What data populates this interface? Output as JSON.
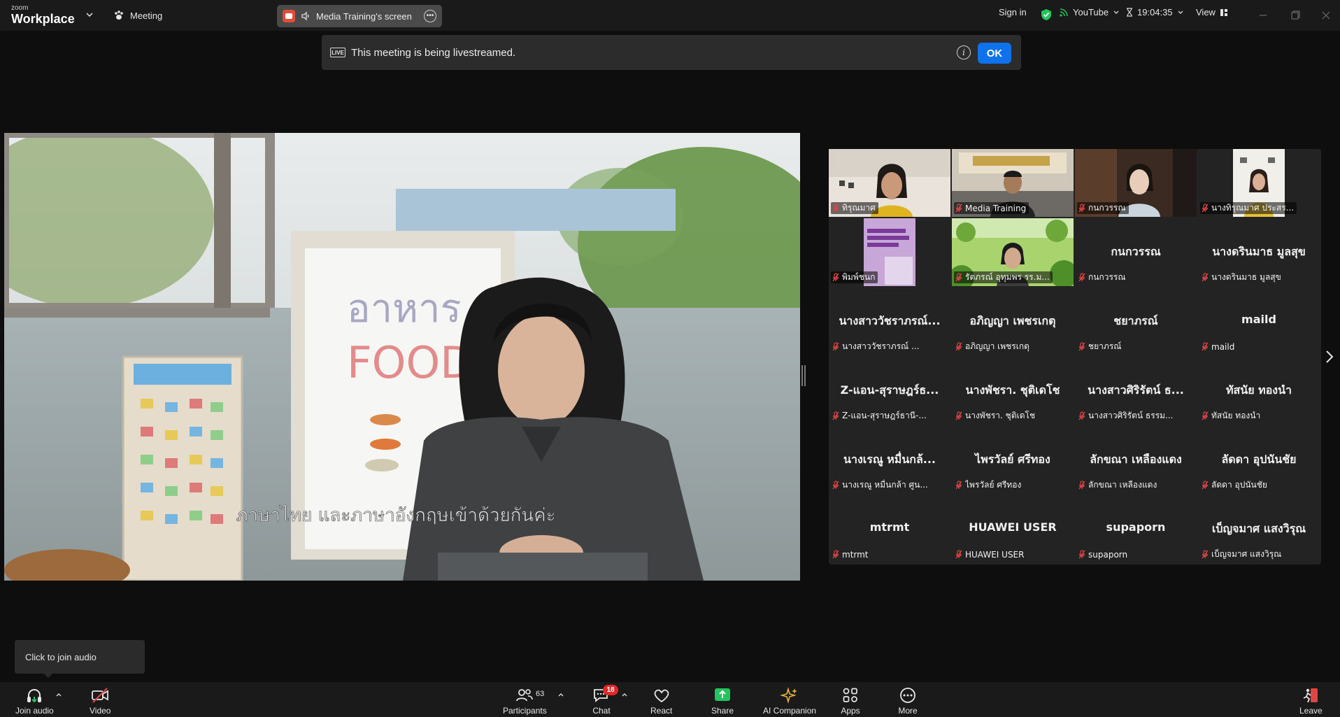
{
  "topbar": {
    "brand_small": "zoom",
    "brand_big": "Workplace",
    "meeting_label": "Meeting",
    "screen_label": "Media Training's screen",
    "sign_in": "Sign in",
    "stream_label": "YouTube",
    "timer": "19:04:35",
    "view_label": "View"
  },
  "banner": {
    "badge": "LIVE",
    "text": "This meeting is being livestreamed.",
    "ok": "OK"
  },
  "share": {
    "board_text": "อาหาร",
    "board_en": "FOOD",
    "subtitle": "ภาษาไทย และภาษาอังกฤษเข้าด้วยกันค่ะ"
  },
  "gallery": {
    "tiles": [
      {
        "big": "",
        "label": "ทิรุณมาศ",
        "video": true
      },
      {
        "big": "",
        "label": "Media Training",
        "video": true,
        "active": true
      },
      {
        "big": "",
        "label": "กนกวรรณ",
        "video": true
      },
      {
        "big": "",
        "label": "นางทิรุณมาศ ประสร...",
        "video": true
      },
      {
        "big": "",
        "label": "พิมพ์ชนก",
        "video": true
      },
      {
        "big": "",
        "label": "รัตภรณ์ อุทุมพร รร.ม...",
        "video": true
      },
      {
        "big": "กนกวรรณ",
        "label": "กนกวรรณ"
      },
      {
        "big": "นางดรินมาธ มูลสุข",
        "label": "นางดรินมาธ มูลสุข"
      },
      {
        "big": "นางสาววัชราภรณ์...",
        "label": "นางสาววัชราภรณ์ ..."
      },
      {
        "big": "อภิญญา เพชรเกตุ",
        "label": "อภิญญา เพชรเกตุ"
      },
      {
        "big": "ชยาภรณ์",
        "label": "ชยาภรณ์"
      },
      {
        "big": "maild",
        "label": "maild"
      },
      {
        "big": "Z-แอน-สุราษฎร์ธ...",
        "label": "Z-แอน-สุราษฎร์ธานี-..."
      },
      {
        "big": "นางพัชรา. ชุติเดโช",
        "label": "นางพัชรา. ชุติเดโช"
      },
      {
        "big": "นางสาวศิริรัตน์ ธ...",
        "label": "นางสาวศิริรัตน์ ธรรม..."
      },
      {
        "big": "ทัสนัย ทองนำ",
        "label": "ทัสนัย ทองนำ"
      },
      {
        "big": "นางเรณู หมื่นกล้...",
        "label": "นางเรณู หมื่นกล้า ศูน..."
      },
      {
        "big": "ไพรวัลย์ ศรีทอง",
        "label": "ไพรวัลย์ ศรีทอง"
      },
      {
        "big": "ลักขณา เหลืองแดง",
        "label": "ลักขณา เหลืองแดง"
      },
      {
        "big": "ลัดดา อุปนันชัย",
        "label": "ลัดดา อุปนันชัย"
      },
      {
        "big": "mtrmt",
        "label": "mtrmt"
      },
      {
        "big": "HUAWEI USER",
        "label": "HUAWEI USER"
      },
      {
        "big": "supaporn",
        "label": "supaporn"
      },
      {
        "big": "เบ็ญจมาศ แสงวิรุณ",
        "label": "เบ็ญจมาศ แสงวิรุณ"
      }
    ]
  },
  "tooltip": "Click to join audio",
  "toolbar": {
    "join_audio": "Join audio",
    "video": "Video",
    "participants": "Participants",
    "participants_count": "63",
    "chat": "Chat",
    "chat_badge": "18",
    "react": "React",
    "share": "Share",
    "ai": "AI Companion",
    "apps": "Apps",
    "more": "More",
    "leave": "Leave"
  },
  "colors": {
    "accent_blue": "#0e72ed",
    "active_green": "#23d959",
    "share_green": "#23c55e",
    "badge_red": "#e02828",
    "mic_off_red": "#e04545"
  }
}
